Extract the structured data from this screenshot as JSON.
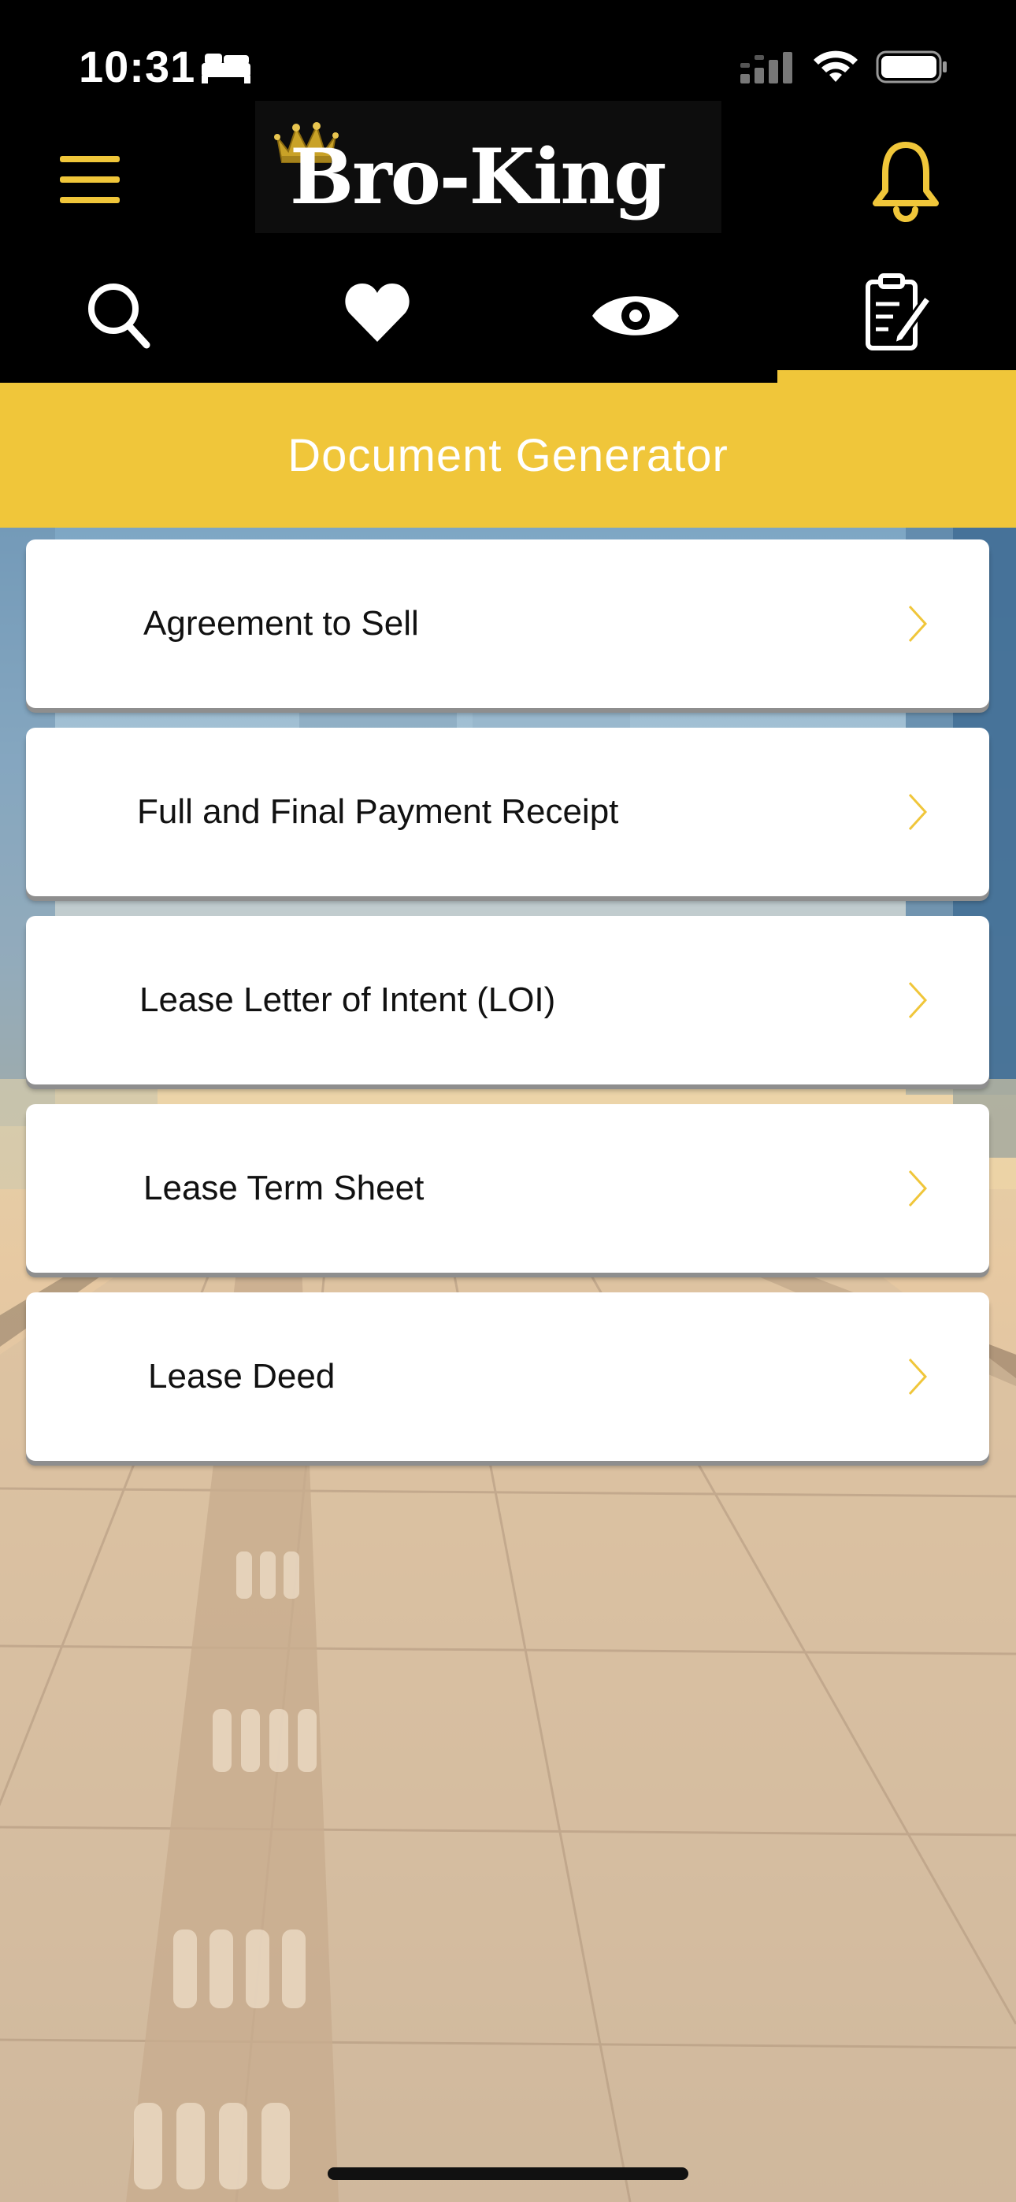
{
  "status_bar": {
    "time": "10:31",
    "sleep_icon": "bed-icon",
    "signal_icon": "cellular-signal-icon",
    "wifi_icon": "wifi-icon",
    "battery_icon": "battery-icon"
  },
  "header": {
    "logo_text": "Bro-King",
    "menu_icon": "hamburger-menu-icon",
    "notification_icon": "bell-icon"
  },
  "tabs": [
    {
      "name": "search",
      "icon": "search-icon"
    },
    {
      "name": "favorites",
      "icon": "heart-icon"
    },
    {
      "name": "viewed",
      "icon": "eye-icon"
    },
    {
      "name": "documents",
      "icon": "edit-document-icon",
      "active": true
    }
  ],
  "title": "Document Generator",
  "documents": [
    {
      "label": "Agreement to Sell"
    },
    {
      "label": "Full and Final Payment Receipt"
    },
    {
      "label": "Lease Letter of Intent (LOI)"
    },
    {
      "label": "Lease Term Sheet"
    },
    {
      "label": "Lease Deed"
    }
  ],
  "colors": {
    "accent": "#f0c63a",
    "header_bg": "#000000",
    "card_bg": "#ffffff",
    "text": "#111111"
  }
}
